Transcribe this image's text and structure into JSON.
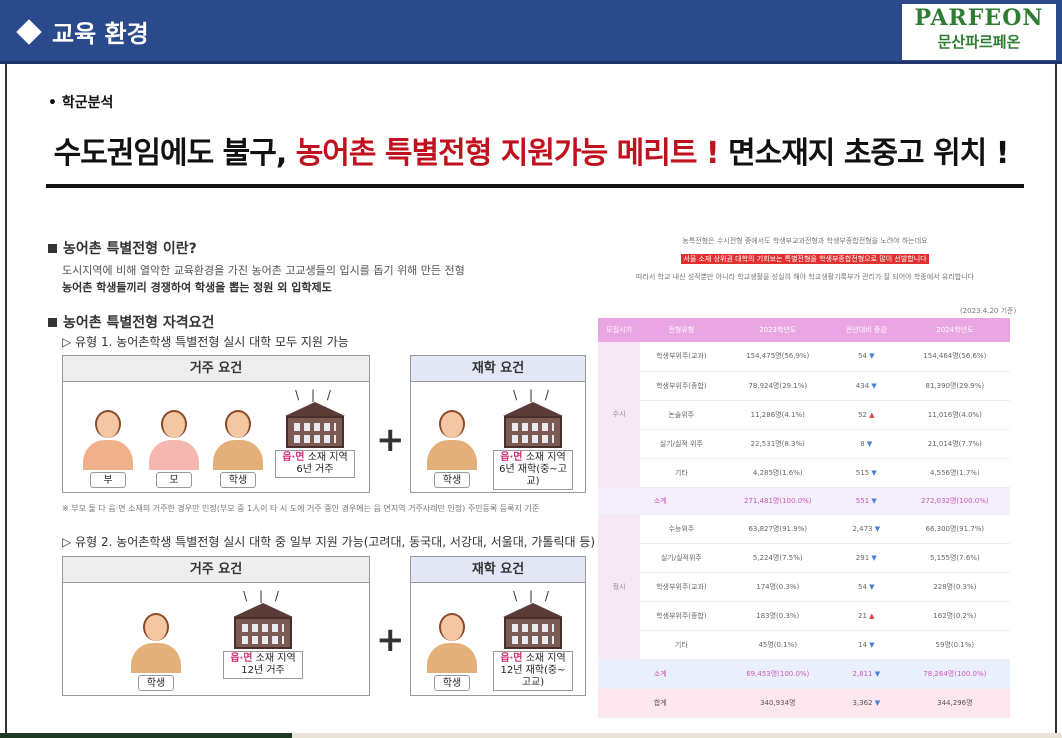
{
  "header": {
    "title": "교육 환경"
  },
  "logo": {
    "en": "PARFEON",
    "ko": "문산파르페온"
  },
  "bullet": "• 학군분석",
  "headline": {
    "part1": "수도권임에도 불구, ",
    "part2": "농어촌 특별전형 지원가능 메리트 !",
    "part3": " 면소재지 초중고 위치 !"
  },
  "section1": {
    "title": "농어촌 특별전형 이란?",
    "line1": "도시지역에 비해 열악한 교육환경을 가진 농어촌 고교생들의 입시를 돕기 위해 만든 전형",
    "line2": "농어촌 학생들끼리 경쟁하여 학생을 뽑는 정원 외 입학제도"
  },
  "section2": {
    "title": "농어촌 특별전형 자격요건",
    "type1": "▷ 유형 1. 농어촌학생 특별전형 실시 대학 모두 지원 가능",
    "type2": "▷ 유형 2. 농어촌학생 특별전형 실시 대학 중 일부 지원 가능(고려대, 동국대, 서강대, 서울대, 가톨릭대 등)"
  },
  "boxes": {
    "residence": "거주 요건",
    "school": "재학 요건"
  },
  "people": {
    "father": "부",
    "mother": "모",
    "student": "학생"
  },
  "captions": {
    "area": "읍·면",
    "region": "소재 지역",
    "res6": "6년 거주",
    "sch6": "6년 재학(중~고교)",
    "res12": "12년 거주",
    "sch12": "12년 재학(중~고교)"
  },
  "footnote": "※ 부모 둘 다 읍·면 소재의 거주한 경우만 인정(부모 중 1人이 타 시 도에 거주 중인 경우에는 읍 면지역 거주사례만 인정) 주민등록 등록지 기준",
  "table_notes": {
    "line1": "농특전형은 수시전형 중에서도 학생부교과전형과 학생부종합전형을 노려야 하는데요",
    "line2": "서울 소재 상위권 대학의 기회보는 특별전형을 학생부종합전형으로 많이 선발합니다",
    "line3": "따라서 학교 내신 성적뿐만 아니라 학교생활을 성실히 해야 학교생활기록부가 관리가 잘 되어야 학종에서 유리합니다",
    "date": "(2023.4.20 기준)"
  },
  "table": {
    "headers": [
      "모집시기",
      "전형유형",
      "2023학년도",
      "전년대비 증감",
      "2024학년도"
    ],
    "susi": {
      "label": "수시",
      "rows": [
        [
          "학생부위주(교과)",
          "154,475명(56.9%)",
          "54",
          "▼",
          "154,464명(56.6%)"
        ],
        [
          "학생부위주(종합)",
          "78,924명(29.1%)",
          "434",
          "▼",
          "81,390명(29.9%)"
        ],
        [
          "논술위주",
          "11,286명(4.1%)",
          "52",
          "▲",
          "11,016명(4.0%)"
        ],
        [
          "실기/실적 위주",
          "22,531명(8.3%)",
          "8",
          "▼",
          "21,014명(7.7%)"
        ],
        [
          "기타",
          "4,285명(1.6%)",
          "515",
          "▼",
          "4,556명(1.7%)"
        ]
      ],
      "subtotal": [
        "소계",
        "271,481명(100.0%)",
        "551",
        "▼",
        "272,032명(100.0%)"
      ]
    },
    "jeongsi": {
      "label": "정시",
      "rows": [
        [
          "수능위주",
          "63,827명(91.9%)",
          "2,473",
          "▼",
          "66,300명(91.7%)"
        ],
        [
          "실기/실적위주",
          "5,224명(7.5%)",
          "291",
          "▼",
          "5,155명(7.6%)"
        ],
        [
          "학생부위주(교과)",
          "174명(0.3%)",
          "54",
          "▼",
          "228명(0.3%)"
        ],
        [
          "학생부위주(종합)",
          "183명(0.3%)",
          "21",
          "▲",
          "162명(0.2%)"
        ],
        [
          "기타",
          "45명(0.1%)",
          "14",
          "▼",
          "59명(0.1%)"
        ]
      ],
      "subtotal": [
        "소계",
        "69,453명(100.0%)",
        "2,811",
        "▼",
        "78,264명(100.0%)"
      ]
    },
    "total": [
      "합계",
      "340,934명",
      "3,362",
      "▼",
      "344,296명"
    ]
  }
}
